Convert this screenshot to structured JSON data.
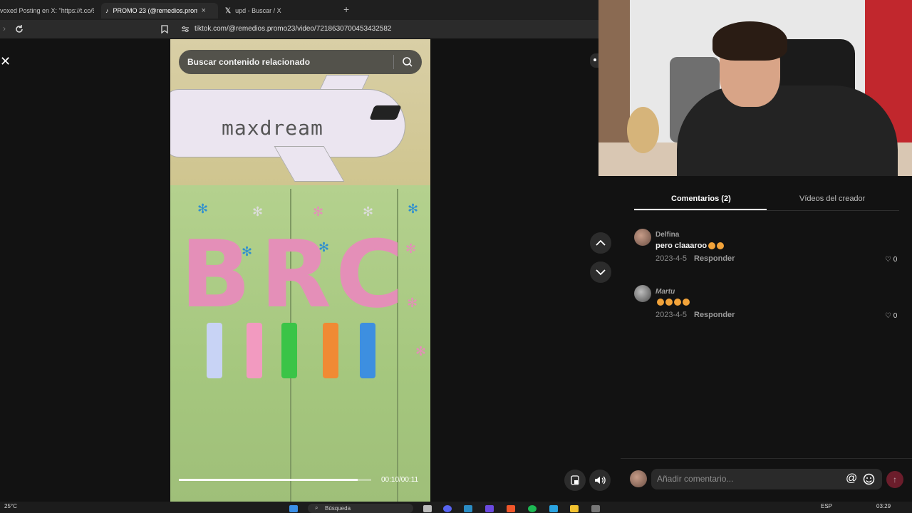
{
  "browser": {
    "tabs": [
      {
        "label": "voxed Posting en X: \"https://t.co/5yM",
        "active": false
      },
      {
        "label": "PROMO 23 (@remedios.promo",
        "active": true
      },
      {
        "label": "upd - Buscar / X",
        "active": false
      }
    ],
    "new_tab_glyph": "+",
    "url": "tiktok.com/@remedios.promo23/video/7218630700453432582"
  },
  "video": {
    "search_placeholder": "Buscar contenido relacionado",
    "plane_text": "maxdream",
    "letters": [
      "B",
      "R",
      "C"
    ],
    "time": "00:10/00:11",
    "progress": 0.93
  },
  "panel": {
    "tabs": [
      "Comentarios (2)",
      "Vídeos del creador"
    ],
    "active_tab": 0,
    "comments": [
      {
        "user": "Delfina",
        "text": "pero claaaroo",
        "date": "2023-4-5",
        "reply": "Responder",
        "likes": "0"
      },
      {
        "user": "Martu",
        "text": "",
        "date": "2023-4-5",
        "reply": "Responder",
        "likes": "0"
      }
    ],
    "comment_placeholder": "Añadir comentario...",
    "at_glyph": "@"
  },
  "taskbar": {
    "weather": "25°C",
    "search": "Búsqueda",
    "lang": "ESP",
    "time": "03:29"
  },
  "colors": {
    "accent": "#fe2c55",
    "background": "#121212"
  }
}
